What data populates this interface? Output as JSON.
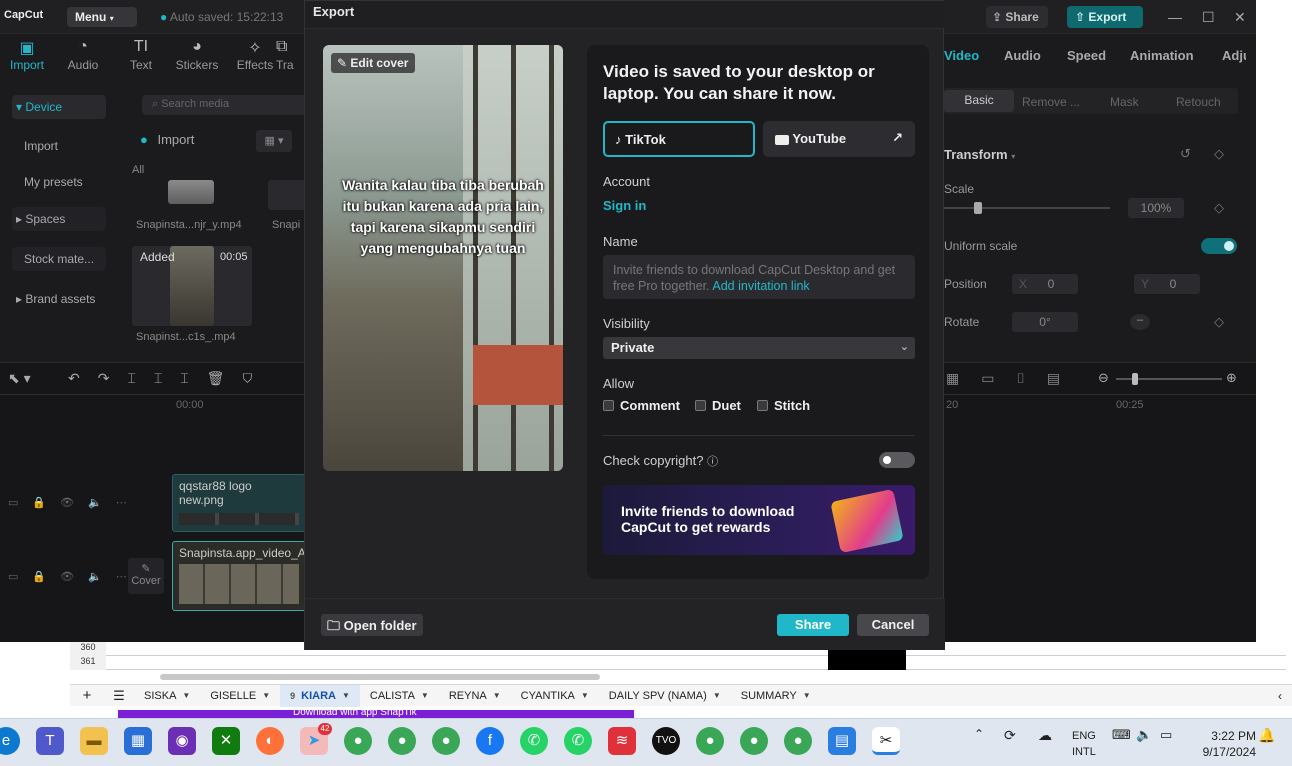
{
  "capcut": {
    "logo": "CapCut",
    "menu": "Menu",
    "autosave": "Auto saved: 15:22:13",
    "share": "Share",
    "export": "Export",
    "tools": [
      {
        "label": "Import",
        "icon": "import-icon"
      },
      {
        "label": "Audio",
        "icon": "audio-icon"
      },
      {
        "label": "Text",
        "icon": "text-icon"
      },
      {
        "label": "Stickers",
        "icon": "stickers-icon"
      },
      {
        "label": "Effects",
        "icon": "effects-icon"
      },
      {
        "label": "Tra",
        "icon": "transitions-icon"
      }
    ],
    "sidebar": [
      "Device",
      "Import",
      "My presets",
      "Spaces",
      "Stock mate...",
      "Brand assets"
    ],
    "media": {
      "search_placeholder": "Search media",
      "import_label": "Import",
      "all_label": "All",
      "clip1": "Snapinsta...njr_y.mp4",
      "clip2": "Snapi",
      "added": "Added",
      "duration": "00:05",
      "clip3": "Snapinst...c1s_.mp4"
    },
    "right_tabs": [
      "Video",
      "Audio",
      "Speed",
      "Animation",
      "Adju"
    ],
    "right_subtabs": [
      "Basic",
      "Remove ...",
      "Mask",
      "Retouch"
    ],
    "transform": "Transform",
    "scale_label": "Scale",
    "scale_value": "100%",
    "uniform_scale": "Uniform scale",
    "position_label": "Position",
    "pos_x_label": "X",
    "pos_x": "0",
    "pos_y_label": "Y",
    "pos_y": "0",
    "rotate_label": "Rotate",
    "rotate_value": "0°",
    "timeline": {
      "t0": "00:00",
      "t20": "20",
      "t25": "00:25",
      "track1": "qqstar88 logo new.png",
      "track2": "Snapinsta.app_video_Ar",
      "cover": "Cover"
    }
  },
  "modal": {
    "title": "Export",
    "edit_cover": "Edit cover",
    "caption": "Wanita kalau tiba tiba berubah itu bukan karena ada pria lain, tapi karena sikapmu sendiri yang mengubahnya tuan",
    "heading": "Video is saved to your desktop or laptop. You can share it now.",
    "platforms": [
      {
        "label": "TikTok",
        "icon": "tiktok-icon"
      },
      {
        "label": "YouTube",
        "icon": "youtube-icon"
      }
    ],
    "account_label": "Account",
    "sign_in": "Sign in",
    "name_label": "Name",
    "name_placeholder": "Invite friends to download CapCut Desktop and get free Pro together.",
    "name_link": "Add invitation link",
    "visibility_label": "Visibility",
    "visibility_value": "Private",
    "allow_label": "Allow",
    "allow_options": [
      "Comment",
      "Duet",
      "Stitch"
    ],
    "copyright_label": "Check copyright?",
    "banner_text": "Invite friends to download CapCut to get rewards",
    "open_folder": "Open folder",
    "share": "Share",
    "cancel": "Cancel"
  },
  "excel": {
    "rows": [
      "360",
      "361"
    ],
    "tabs": [
      "SISKA",
      "GISELLE",
      "KIARA",
      "CALISTA",
      "REYNA",
      "CYANTIKA",
      "DAILY SPV (NAMA)",
      "SUMMARY"
    ],
    "active_tab_num": "9",
    "banner": "Download with app SnapTik"
  },
  "taskbar": {
    "telegram_badge": "42",
    "lang1": "ENG",
    "lang2": "INTL",
    "time": "3:22 PM",
    "date": "9/17/2024"
  }
}
